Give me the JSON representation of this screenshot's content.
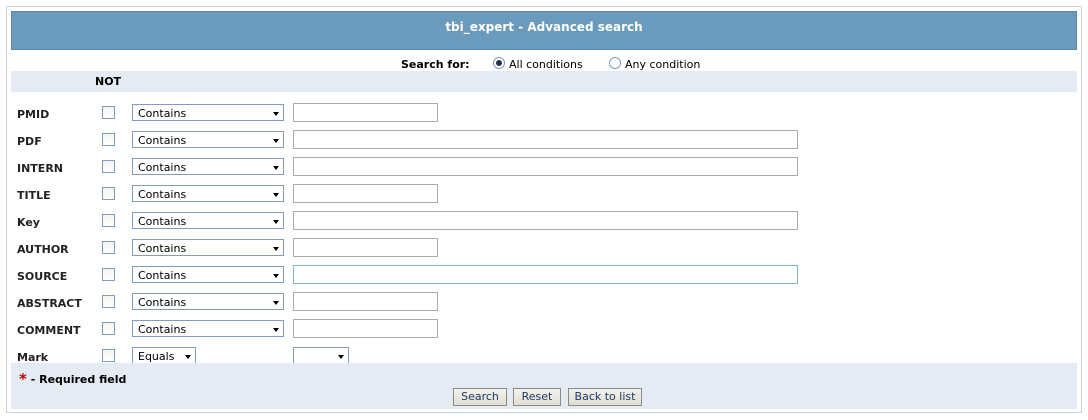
{
  "header": {
    "title": "tbi_expert - Advanced search"
  },
  "search_for": {
    "label": "Search for:",
    "options": [
      {
        "label": "All conditions",
        "checked": true
      },
      {
        "label": "Any condition",
        "checked": false
      }
    ]
  },
  "not_label": "NOT",
  "fields": [
    {
      "label": "PMID",
      "operator": "Contains",
      "value": "",
      "not": false
    },
    {
      "label": "PDF",
      "operator": "Contains",
      "value": "",
      "not": false
    },
    {
      "label": "INTERN",
      "operator": "Contains",
      "value": "",
      "not": false
    },
    {
      "label": "TITLE",
      "operator": "Contains",
      "value": "",
      "not": false
    },
    {
      "label": "Key",
      "operator": "Contains",
      "value": "",
      "not": false
    },
    {
      "label": "AUTHOR",
      "operator": "Contains",
      "value": "",
      "not": false
    },
    {
      "label": "SOURCE",
      "operator": "Contains",
      "value": "",
      "not": false
    },
    {
      "label": "ABSTRACT",
      "operator": "Contains",
      "value": "",
      "not": false
    },
    {
      "label": "COMMENT",
      "operator": "Contains",
      "value": "",
      "not": false
    },
    {
      "label": "Mark",
      "operator": "Equals",
      "value": "",
      "not": false
    }
  ],
  "required_note": {
    "star": "*",
    "text": "- Required field"
  },
  "buttons": {
    "search": "Search",
    "reset": "Reset",
    "back": "Back to list"
  },
  "colors": {
    "header_bg": "#6a9bbc",
    "band_bg": "#e4ebf3",
    "required_star": "#cc0000"
  }
}
